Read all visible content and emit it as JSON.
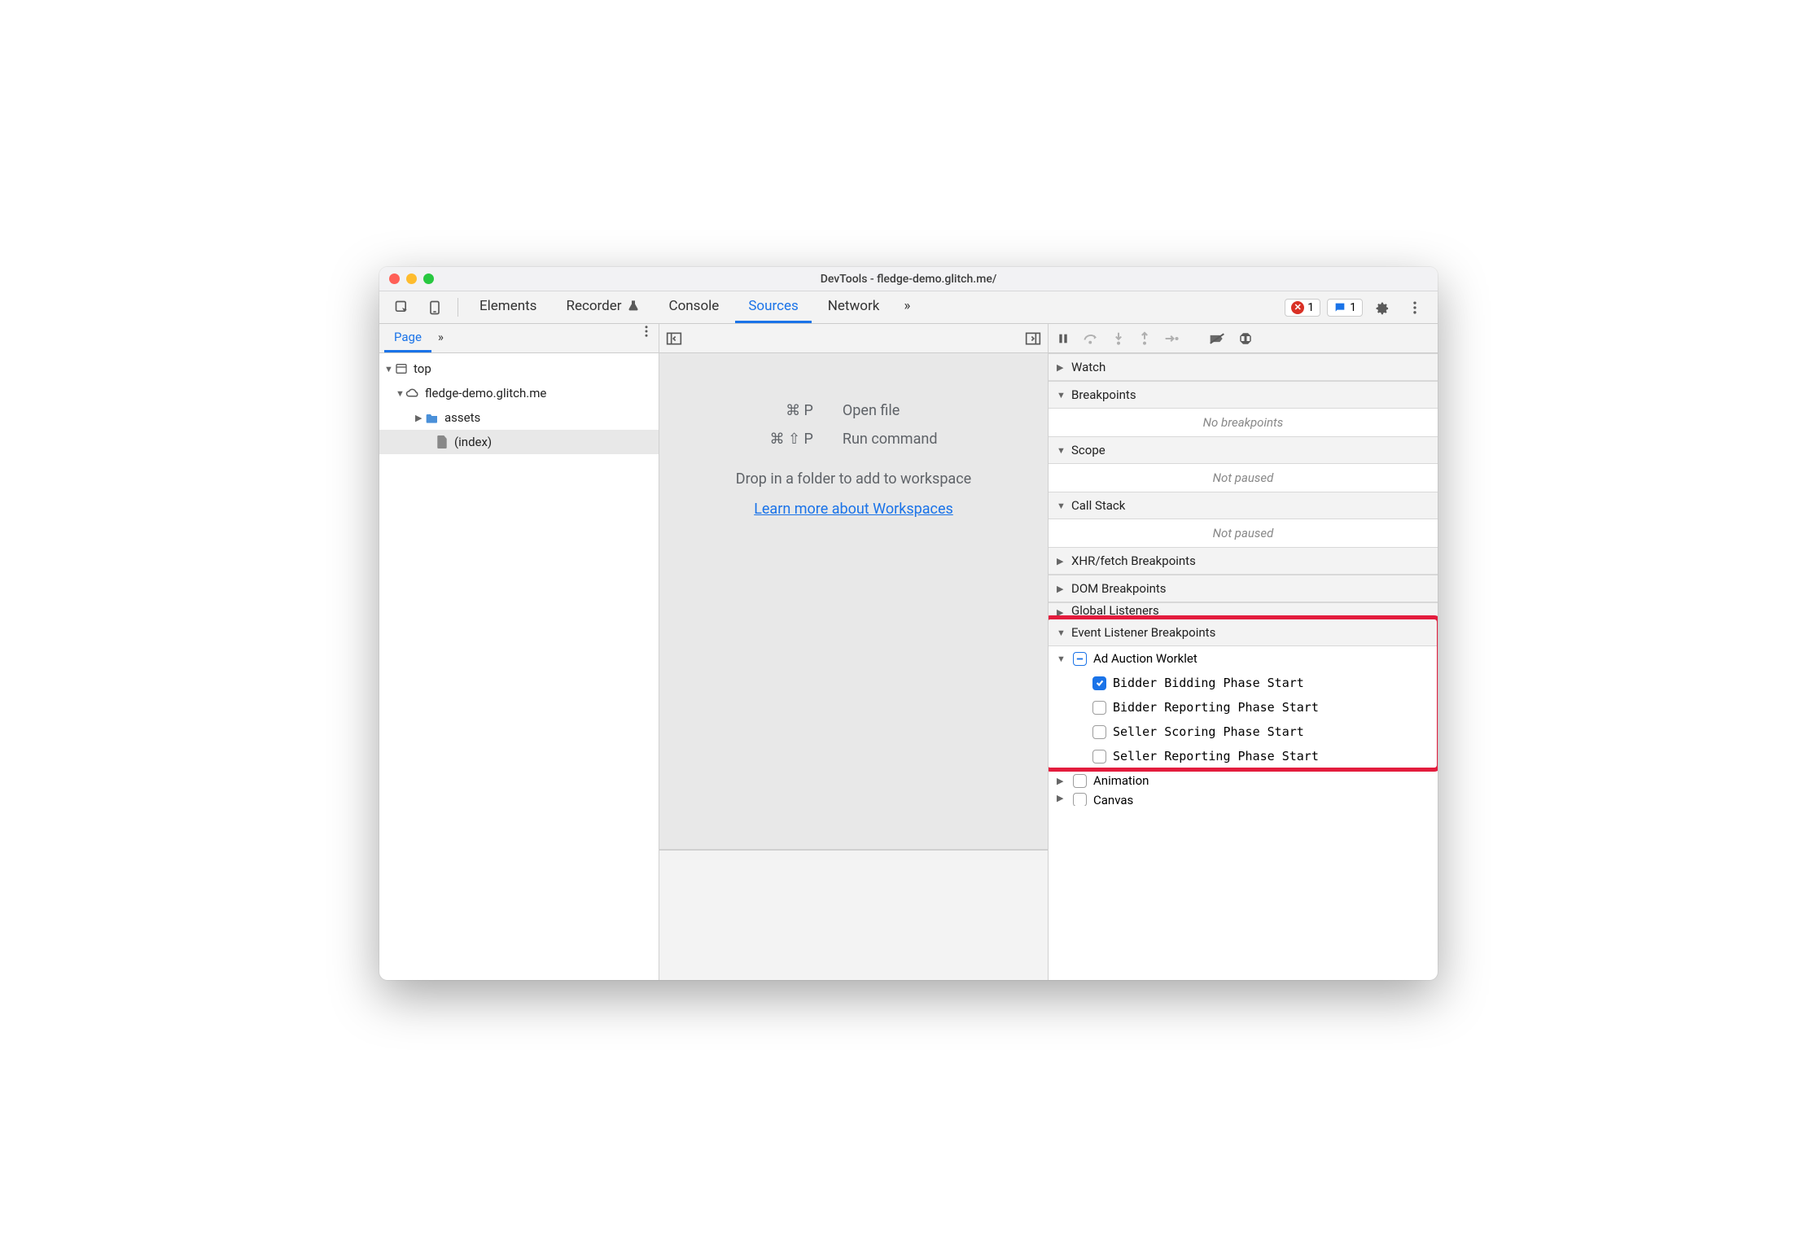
{
  "window": {
    "title": "DevTools - fledge-demo.glitch.me/"
  },
  "mainTabs": {
    "items": [
      "Elements",
      "Recorder",
      "Console",
      "Sources",
      "Network"
    ],
    "active": "Sources",
    "overflow": "»"
  },
  "badges": {
    "errors": "1",
    "messages": "1"
  },
  "left": {
    "subTab": "Page",
    "overflow": "»",
    "tree": {
      "top": "top",
      "origin": "fledge-demo.glitch.me",
      "folder": "assets",
      "file": "(index)"
    }
  },
  "center": {
    "hints": {
      "openKeys": "⌘ P",
      "openLabel": "Open file",
      "runKeys": "⌘ ⇧ P",
      "runLabel": "Run command"
    },
    "dropText": "Drop in a folder to add to workspace",
    "link": "Learn more about Workspaces"
  },
  "right": {
    "sections": {
      "watch": "Watch",
      "breakpoints": "Breakpoints",
      "breakpointsEmpty": "No breakpoints",
      "scope": "Scope",
      "scopeEmpty": "Not paused",
      "callstack": "Call Stack",
      "callstackEmpty": "Not paused",
      "xhr": "XHR/fetch Breakpoints",
      "dom": "DOM Breakpoints",
      "global": "Global Listeners",
      "eventListener": "Event Listener Breakpoints"
    },
    "adAuction": {
      "category": "Ad Auction Worklet",
      "items": [
        {
          "label": "Bidder Bidding Phase Start",
          "checked": true
        },
        {
          "label": "Bidder Reporting Phase Start",
          "checked": false
        },
        {
          "label": "Seller Scoring Phase Start",
          "checked": false
        },
        {
          "label": "Seller Reporting Phase Start",
          "checked": false
        }
      ]
    },
    "animation": "Animation",
    "canvas": "Canvas"
  }
}
